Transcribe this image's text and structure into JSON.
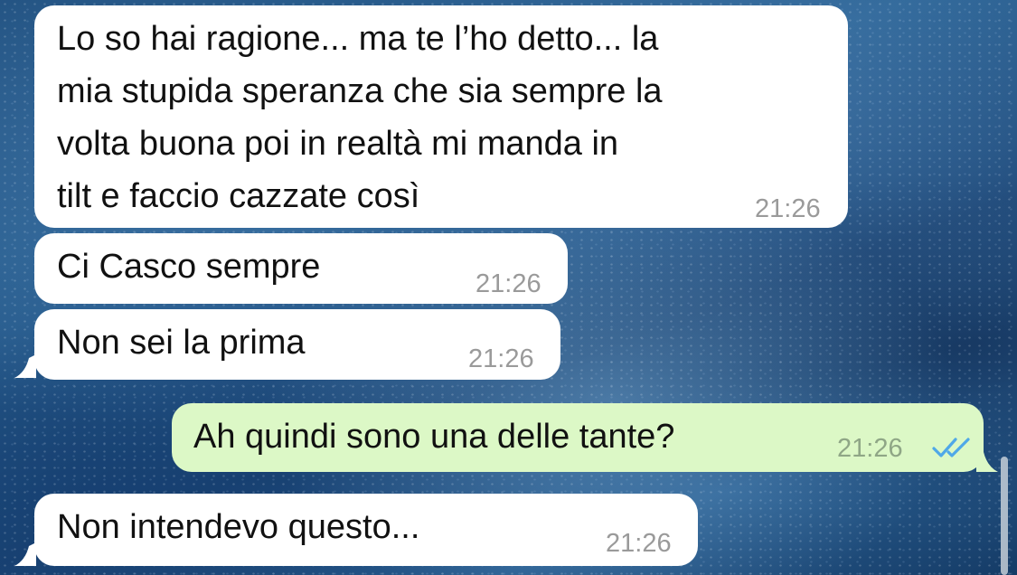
{
  "messages": [
    {
      "direction": "incoming",
      "text": "Lo so hai ragione... ma te l’ho detto... la\nmia stupida speranza che sia sempre la\nvolta buona poi in realtà mi manda in\ntilt e faccio cazzate così",
      "time": "21:26"
    },
    {
      "direction": "incoming",
      "text": "Ci Casco sempre",
      "time": "21:26"
    },
    {
      "direction": "incoming",
      "text": "Non sei la prima",
      "time": "21:26"
    },
    {
      "direction": "outgoing",
      "text": "Ah quindi sono una delle tante?",
      "time": "21:26",
      "status": "read",
      "status_icon": "double-check-icon"
    },
    {
      "direction": "incoming",
      "text": "Non intendevo questo...",
      "time": "21:26"
    }
  ],
  "colors": {
    "incoming_bubble": "#ffffff",
    "outgoing_bubble": "#dcf8c6",
    "read_ticks": "#4fa8e8",
    "timestamp": "#9a9a9a"
  }
}
